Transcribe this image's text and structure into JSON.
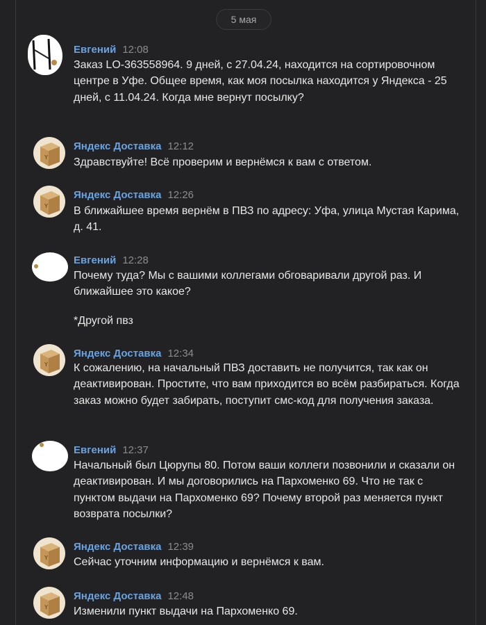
{
  "chat": {
    "date_separator": "5 мая",
    "messages": [
      {
        "author": "Евгений",
        "time": "12:08",
        "avatar": "user-avatar-censored",
        "paragraphs": [
          "Заказ LO-363558964. 9 дней, с 27.04.24, находится на сортировочном центре в Уфе. Общее время, как моя посылка находится у Яндекса - 25 дней, с 11.04.24. Когда мне вернут посылку?"
        ]
      },
      {
        "author": "Яндекс Доставка",
        "time": "12:12",
        "avatar": "parcel-box-avatar",
        "paragraphs": [
          "Здравствуйте! Всё проверим и вернёмся к вам с ответом."
        ]
      },
      {
        "author": "Яндекс Доставка",
        "time": "12:26",
        "avatar": "parcel-box-avatar",
        "paragraphs": [
          "В ближайшее время вернём в ПВЗ по адресу: Уфа, улица Мустая Карима, д. 41."
        ]
      },
      {
        "author": "Евгений",
        "time": "12:28",
        "avatar": "user-avatar-censored",
        "paragraphs": [
          "Почему туда? Мы с вашими коллегами обговаривали другой раз. И ближайшее это какое?",
          "*Другой пвз"
        ]
      },
      {
        "author": "Яндекс Доставка",
        "time": "12:34",
        "avatar": "parcel-box-avatar",
        "paragraphs": [
          "К сожалению, на начальный ПВЗ доставить не получится, так как он деактивирован. Простите, что вам приходится во всём разбираться. Когда заказ можно будет забирать, поступит смс-код для получения заказа."
        ]
      },
      {
        "author": "Евгений",
        "time": "12:37",
        "avatar": "user-avatar-censored",
        "paragraphs": [
          "Начальный был Цюрупы 80. Потом ваши коллеги позвонили и сказали он деактивирован. И мы договорились на Пархоменко 69. Что не так с пунктом выдачи на Пархоменко 69? Почему второй раз меняется пункт возврата посылки?"
        ]
      },
      {
        "author": "Яндекс Доставка",
        "time": "12:39",
        "avatar": "parcel-box-avatar",
        "paragraphs": [
          "Сейчас уточним информацию и вернёмся к вам."
        ]
      },
      {
        "author": "Яндекс Доставка",
        "time": "12:48",
        "avatar": "parcel-box-avatar",
        "paragraphs": [
          "Изменили пункт выдачи на Пархоменко 69."
        ]
      }
    ]
  }
}
